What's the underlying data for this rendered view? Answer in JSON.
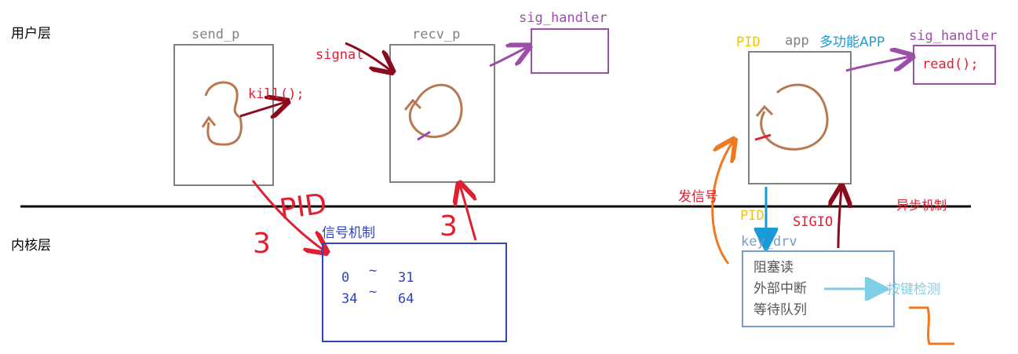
{
  "layers": {
    "user": "用户层",
    "kernel": "内核层",
    "async": "异步机制"
  },
  "processes": {
    "send_p": "send_p",
    "recv_p": "recv_p",
    "sig_handler_left": "sig_handler",
    "app": "app",
    "app_desc": "多功能APP",
    "sig_handler_right": "sig_handler",
    "read_call": "read();"
  },
  "labels": {
    "kill": "kill();",
    "signal": "signal",
    "pid_big": "PID",
    "three_left": "3",
    "three_right": "3",
    "signal_mech": "信号机制",
    "range1_lo": "0",
    "range1_hi": "31",
    "range2_lo": "34",
    "range2_hi": "64",
    "tilde": "~",
    "pid_app": "PID",
    "pid_drv": "PID",
    "send_signal": "发信号",
    "sigio": "SIGIO",
    "key_drv": "key_drv",
    "blocking_read": "阻塞读",
    "ext_irq": "外部中断",
    "wait_queue": "等待队列",
    "key_detect": "按键检测"
  },
  "colors": {
    "box_gray": "#808080",
    "purple": "#9b4fa8",
    "red": "#e02030",
    "dark_red": "#8b0a1e",
    "brown": "#b87850",
    "blue": "#3344bb",
    "cyan": "#1a9ad6",
    "steel_blue": "#7a9cc8",
    "light_cyan": "#80cde6",
    "orange": "#f07820",
    "yellow": "#f5c400"
  }
}
